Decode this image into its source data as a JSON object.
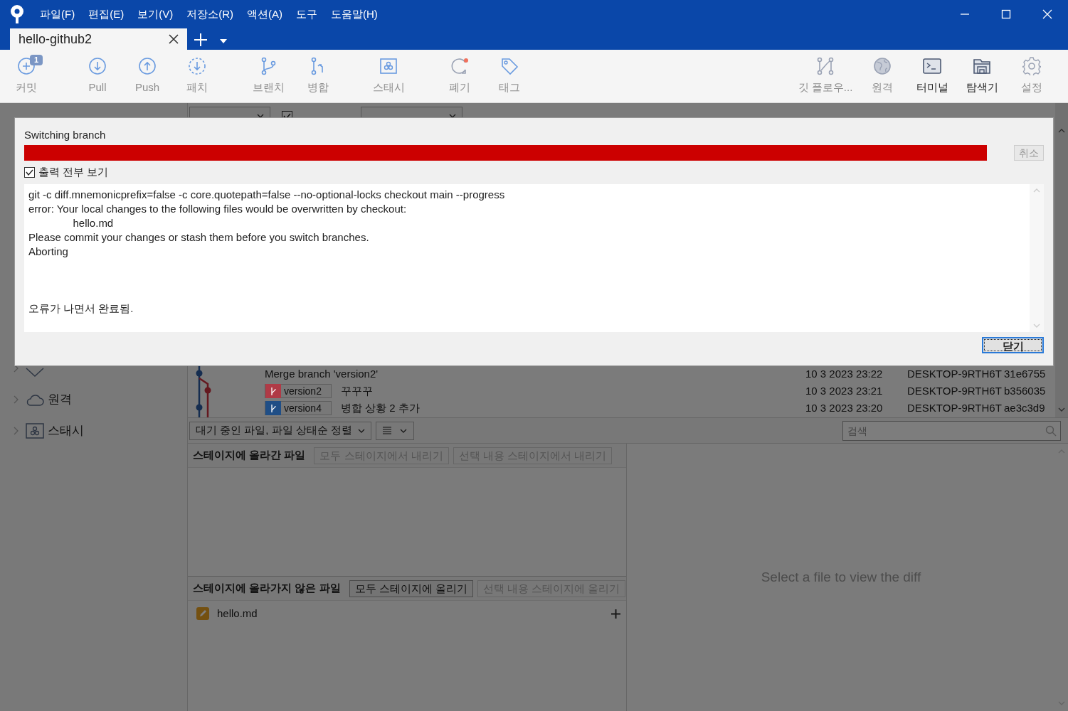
{
  "window": {
    "menu": [
      "파일(F)",
      "편집(E)",
      "보기(V)",
      "저장소(R)",
      "액션(A)",
      "도구",
      "도움말(H)"
    ]
  },
  "tabs": [
    {
      "label": "hello-github2",
      "selected": true
    }
  ],
  "toolbar": [
    {
      "kind": "commit",
      "label": "커밋",
      "badge": "1",
      "disabled": true
    },
    {
      "kind": "pull",
      "label": "Pull",
      "disabled": true
    },
    {
      "kind": "push",
      "label": "Push",
      "disabled": true
    },
    {
      "kind": "fetch",
      "label": "패치",
      "disabled": true
    },
    {
      "kind": "branch",
      "label": "브랜치",
      "disabled": true
    },
    {
      "kind": "merge",
      "label": "병합",
      "disabled": true
    },
    {
      "kind": "stash",
      "label": "스태시",
      "disabled": true
    },
    {
      "kind": "discard",
      "label": "폐기",
      "disabled": true
    },
    {
      "kind": "tag",
      "label": "태그",
      "disabled": true
    }
  ],
  "toolbar_right": [
    {
      "kind": "flow",
      "label": "깃 플로우...",
      "disabled": true
    },
    {
      "kind": "remote",
      "label": "원격",
      "disabled": true
    },
    {
      "kind": "terminal",
      "label": "터미널",
      "disabled": false
    },
    {
      "kind": "explorer",
      "label": "탐색기",
      "disabled": false
    },
    {
      "kind": "settings",
      "label": "설정",
      "disabled": true
    }
  ],
  "sidebar": {
    "items": [
      {
        "kind": "tag",
        "expanded": false
      },
      {
        "kind": "remote",
        "label": "원격",
        "expanded": false
      },
      {
        "kind": "stash",
        "label": "스태시",
        "expanded": false
      }
    ]
  },
  "history_filter": {
    "remote_branches": {
      "checked": true
    }
  },
  "commits": [
    {
      "message": "Merge branch 'version2'",
      "date": "10 3 2023 23:22",
      "author": "DESKTOP-9RTH6T",
      "hash": "31e6755"
    },
    {
      "branch": {
        "label": "version2",
        "color": "#b03a46"
      },
      "message": "꾸꾸꾸",
      "date": "10 3 2023 23:21",
      "author": "DESKTOP-9RTH6T",
      "hash": "b356035"
    },
    {
      "branch": {
        "label": "version4",
        "color": "#1f4e86"
      },
      "message": "병합 상황 2 추가",
      "date": "10 3 2023 23:20",
      "author": "DESKTOP-9RTH6T",
      "hash": "ae3c3d9"
    }
  ],
  "file_filter": {
    "sort": "대기 중인 파일, 파일 상태순 정렬",
    "search": {
      "placeholder": "검색"
    }
  },
  "staged": {
    "title": "스테이지에 올라간 파일",
    "buttons": [
      {
        "label": "모두 스테이지에서 내리기",
        "disabled": true
      },
      {
        "label": "선택 내용 스테이지에서 내리기",
        "disabled": true
      }
    ]
  },
  "unstaged": {
    "title": "스테이지에 올라가지 않은 파일",
    "buttons": [
      {
        "label": "모두 스테이지에 올리기",
        "disabled": false
      },
      {
        "label": "선택 내용 스테이지에 올리기",
        "disabled": true
      }
    ],
    "files": [
      {
        "name": "hello.md"
      }
    ]
  },
  "diff": {
    "message": "Select a file to view the diff"
  },
  "dialog": {
    "title": "Switching branch",
    "progress": {
      "error": true
    },
    "cancel": {
      "label": "취소",
      "disabled": true
    },
    "show_all": {
      "label": "출력 전부 보기",
      "checked": true
    },
    "output": "git -c diff.mnemonicprefix=false -c core.quotepath=false --no-optional-locks checkout main --progress\nerror: Your local changes to the following files would be overwritten by checkout:\n\thello.md\nPlease commit your changes or stash them before you switch branches.\nAborting\n\n\n\n오류가 나면서 완료됨.",
    "close": {
      "label": "닫기",
      "focused": true
    }
  }
}
